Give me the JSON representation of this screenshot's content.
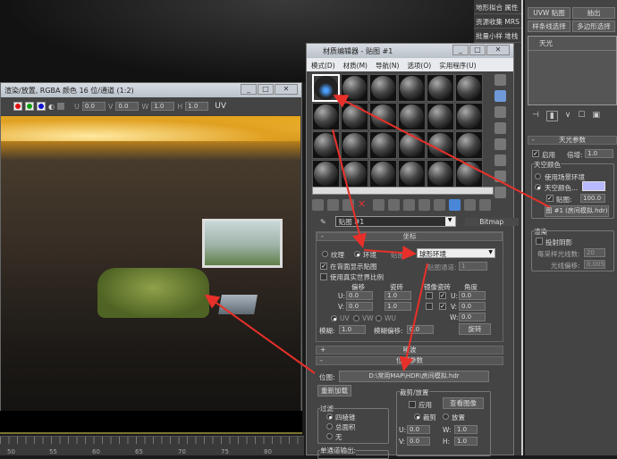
{
  "image_window": {
    "title": "渲染/放置, RGBA 颜色 16 位/通道 (1:2)",
    "toolbar": {
      "u_label": "U",
      "u": "0.0",
      "v_label": "V",
      "v": "0.0",
      "w_label": "W",
      "w": "1.0",
      "h_label": "H",
      "h": "1.0",
      "uv_label": "UV"
    },
    "colors": {
      "red": "#e01010",
      "green": "#10a010",
      "blue": "#1010d0"
    }
  },
  "timeline": {
    "ticks": [
      "50",
      "55",
      "60",
      "65",
      "70",
      "75",
      "80"
    ]
  },
  "material_editor": {
    "title": "材质编辑器 - 贴图 #1",
    "menu": [
      "模式(D)",
      "材质(M)",
      "导航(N)",
      "选项(O)",
      "实用程序(U)"
    ],
    "map_name": "贴图 #1",
    "map_type": "Bitmap",
    "coords": {
      "header": "坐标",
      "texture": "纹理",
      "environ": "环境",
      "mapping_label": "贴图:",
      "mapping": "球形环境",
      "show_back": "在背面显示贴图",
      "map_channel_label": "贴图通道:",
      "map_channel": "1",
      "real_world": "使用真实世界比例",
      "offset": "偏移",
      "tiling": "瓷砖",
      "mirror": "镜像",
      "tile": "瓷砖",
      "angle": "角度",
      "u": "U:",
      "v": "V:",
      "w": "W:",
      "u_offset": "0.0",
      "v_offset": "0.0",
      "u_tiling": "1.0",
      "v_tiling": "1.0",
      "u_angle": "0.0",
      "v_angle": "0.0",
      "w_angle": "0.0",
      "uv": "UV",
      "vw": "VW",
      "wu": "WU",
      "blur_label": "模糊:",
      "blur": "1.0",
      "blur_offset_label": "模糊偏移:",
      "blur_offset": "0.0",
      "rotate": "旋转"
    },
    "noise_header": "噪波",
    "bitmap_params": {
      "header": "位图参数",
      "bitmap_label": "位图:",
      "path": "D:\\常用MAP\\HDR\\房间模拟.hdr",
      "reload": "重新加载",
      "crop_header": "裁剪/放置",
      "apply": "应用",
      "view_image": "查看图像",
      "crop": "裁剪",
      "place": "放置",
      "u": "U:",
      "u_val": "0.0",
      "v": "V:",
      "v_val": "0.0",
      "w": "W:",
      "w_val": "1.0",
      "h": "H:",
      "h_val": "1.0",
      "filter_header": "过滤",
      "pyramidal": "四棱锥",
      "summed": "总面积",
      "none": "无",
      "mono_header": "单通道输出:"
    }
  },
  "label_column": [
    "地形拟合",
    "属性",
    "资源收集",
    "MRS",
    "批量小样",
    "堆栈"
  ],
  "command_panel": {
    "buttons": [
      "UVW 贴图",
      "抽出",
      "样条线选择",
      "多边形选择"
    ],
    "modifier_stack": [
      "天光"
    ],
    "skylight": {
      "header": "天光参数",
      "on": "启用",
      "multiplier_label": "倍增:",
      "multiplier": "1.0",
      "sky_color_group": "天空颜色",
      "use_scene_env": "使用场景环境",
      "sky_color": "天空颜色...",
      "map_label": "贴图:",
      "map_amount": "100.0",
      "map_button": "图 #1 (房间模拟.hdr)",
      "render_group": "渲染",
      "cast_shadows": "投射阴影",
      "rays_label": "每采样光线数:",
      "rays": "20",
      "bias_label": "光线偏移:",
      "bias": "0.005",
      "swatch_color": "#b9b9ff"
    }
  }
}
